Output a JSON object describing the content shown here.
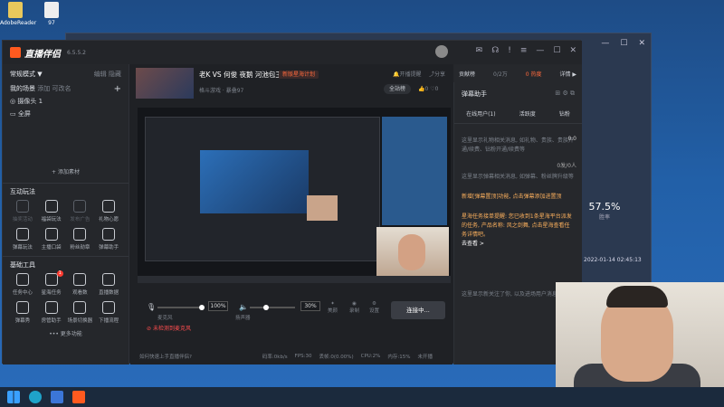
{
  "desktop": {
    "icons": [
      {
        "label": "AdobeReader"
      },
      {
        "label": "97"
      }
    ]
  },
  "bg_window": {
    "rate_value": "57.5%",
    "rate_label": "胜率",
    "timestamp": "2022-01-14 02:45:13"
  },
  "app": {
    "title": "直播伴侣",
    "version": "6.5.5.2",
    "left": {
      "mode_label": "常规模式 ▼",
      "edit": "编辑",
      "close": "隐藏",
      "scenes_title": "我的场景",
      "scene_tab2": "添加",
      "scene_tab3": "可改名",
      "add": "+",
      "sources": [
        {
          "label": "摄像头 1"
        },
        {
          "label": "全屏"
        }
      ],
      "add_material": "+ 添加素材",
      "interactive_title": "互动玩法",
      "interactive": [
        {
          "label": "抽奖活动",
          "dim": true
        },
        {
          "label": "福袋玩法"
        },
        {
          "label": "发布广告",
          "dim": true
        },
        {
          "label": "礼物心愿"
        },
        {
          "label": "弹幕玩法"
        },
        {
          "label": "主播口袋"
        },
        {
          "label": "粉丝勋章"
        },
        {
          "label": "弹幕助手"
        }
      ],
      "tools_title": "基础工具",
      "tools": [
        {
          "label": "任务中心"
        },
        {
          "label": "星海任务"
        },
        {
          "label": "观看数"
        },
        {
          "label": "直播数据"
        },
        {
          "label": "弹幕秀"
        },
        {
          "label": "房管助手"
        },
        {
          "label": "场景切换器"
        },
        {
          "label": "下播流程"
        }
      ],
      "tools_badge": "1",
      "more": "••• 更多功能"
    },
    "center": {
      "stream_title": "老K VS 何俊 夜鹅 河池包王",
      "stream_tag": "新版星海计划",
      "category": "格斗游戏 · 暴叠97",
      "start_btn": "开播提醒",
      "share": "分享",
      "fans": "全站榜",
      "likes": "0",
      "hearts": "0",
      "mic_label": "麦克风",
      "mic_vol": "100%",
      "spk_label": "扬声器",
      "spk_vol": "30%",
      "beauty": "美颜",
      "record": "录制",
      "settings": "设置",
      "connect_btn": "连接中...",
      "warn": "未检测到麦克风",
      "footer": {
        "tip": "如何快速上手直播伴侣?",
        "bitrate": "码率:0kb/s",
        "fps": "FPS:30",
        "drop": "丢帧:0(0.00%)",
        "cpu": "CPU:2%",
        "mem": "内存:15%",
        "status": "未开播"
      }
    },
    "right": {
      "contrib": "贡献榜",
      "count": "0/2万",
      "hot": "0 热度",
      "detail": "详情 ▶",
      "assistant": "弹幕助手",
      "tabs": [
        {
          "label": "在线用户(1)"
        },
        {
          "label": "活跃度"
        },
        {
          "label": "钻粉"
        }
      ],
      "msg1": "这里显示礼物相关消息, 如礼物、贵族、贵族开通/续费、钻粉开通/续费等",
      "score": "0.0",
      "msg2": "这里显示弹幕相关消息, 如弹幕、粉丝牌升级等",
      "count2": "0发/0人",
      "msg3": "新增[弹幕置顶]功能, 点击弹幕添加进置顶",
      "msg4": "星海任务接单提醒: 您已收到1条星海平台派发的任务, 产品名称: 风之剑舞, 点击星海查看任务详情吧。",
      "go": "去查看 >",
      "msg5": "这里显示新关注了你, 以及进场用户消息"
    }
  },
  "colors": {
    "accent": "#ff5a1f",
    "bg": "#1f2125",
    "panel": "#26282c"
  }
}
